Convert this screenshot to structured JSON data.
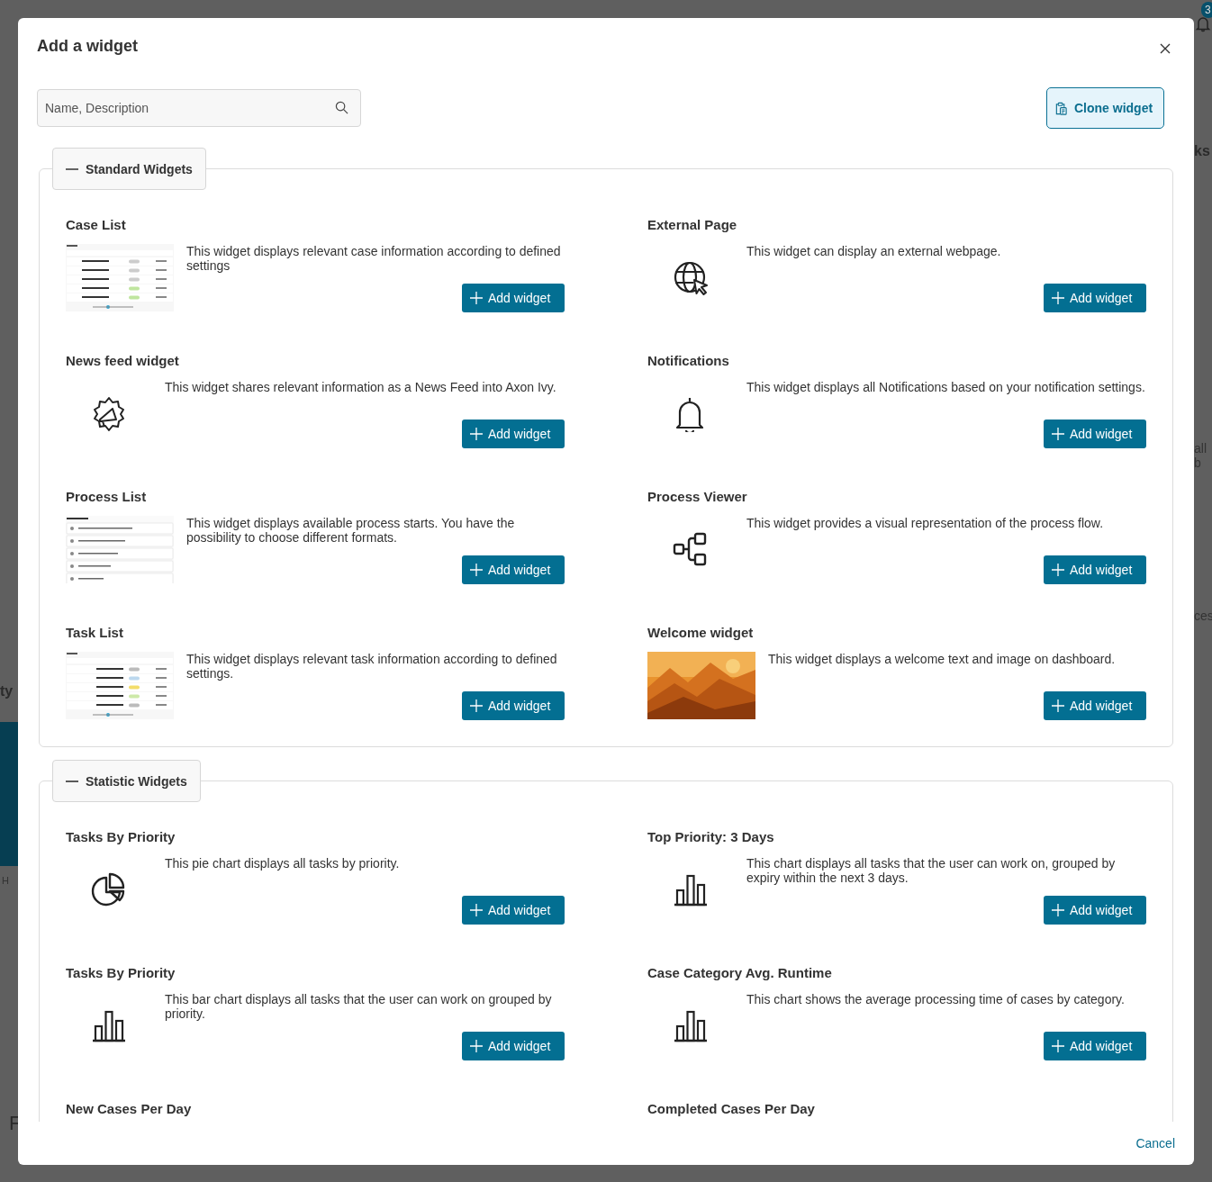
{
  "background": {
    "badge": "3",
    "fragments": [
      "ks",
      "all b",
      "ces",
      "ty",
      "H",
      "F"
    ]
  },
  "dialog": {
    "title": "Add a widget",
    "search": {
      "placeholder": "Name, Description"
    },
    "clone_button": "Clone widget",
    "sections": [
      {
        "title": "Standard Widgets",
        "expanded": true,
        "widgets": [
          {
            "title": "Case List",
            "description": "This widget displays relevant case information according to defined settings",
            "kind": "casetable",
            "button": "Add widget"
          },
          {
            "title": "External Page",
            "description": "This widget can display an external webpage.",
            "kind": "globe",
            "button": "Add widget"
          },
          {
            "title": "News feed widget",
            "description": "This widget shares relevant information as a News Feed into Axon Ivy.",
            "kind": "megaphone",
            "button": "Add widget"
          },
          {
            "title": "Notifications",
            "description": "This widget displays all Notifications based on your notification settings.",
            "kind": "bell",
            "button": "Add widget"
          },
          {
            "title": "Process List",
            "description": "This widget displays available process starts. You have the possibility to choose different formats.",
            "kind": "processlist",
            "button": "Add widget"
          },
          {
            "title": "Process Viewer",
            "description": "This widget provides a visual representation of the process flow.",
            "kind": "flow",
            "button": "Add widget"
          },
          {
            "title": "Task List",
            "description": "This widget displays relevant task information according to defined settings.",
            "kind": "tasktable",
            "button": "Add widget"
          },
          {
            "title": "Welcome widget",
            "description": "This widget displays a welcome text and image on dashboard.",
            "kind": "picture",
            "button": "Add widget"
          }
        ]
      },
      {
        "title": "Statistic Widgets",
        "expanded": true,
        "widgets": [
          {
            "title": "Tasks By Priority",
            "description": "This pie chart displays all tasks by priority.",
            "kind": "pie",
            "button": "Add widget"
          },
          {
            "title": "Top Priority: 3 Days",
            "description": "This chart displays all tasks that the user can work on, grouped by expiry within the next 3 days.",
            "kind": "bars",
            "button": "Add widget"
          },
          {
            "title": "Tasks By Priority",
            "description": "This bar chart displays all tasks that the user can work on grouped by priority.",
            "kind": "bars",
            "button": "Add widget"
          },
          {
            "title": "Case Category Avg. Runtime",
            "description": "This chart shows the average processing time of cases by category.",
            "kind": "bars",
            "button": "Add widget"
          },
          {
            "title": "New Cases Per Day"
          },
          {
            "title": "Completed Cases Per Day"
          }
        ]
      }
    ],
    "cancel": "Cancel"
  }
}
